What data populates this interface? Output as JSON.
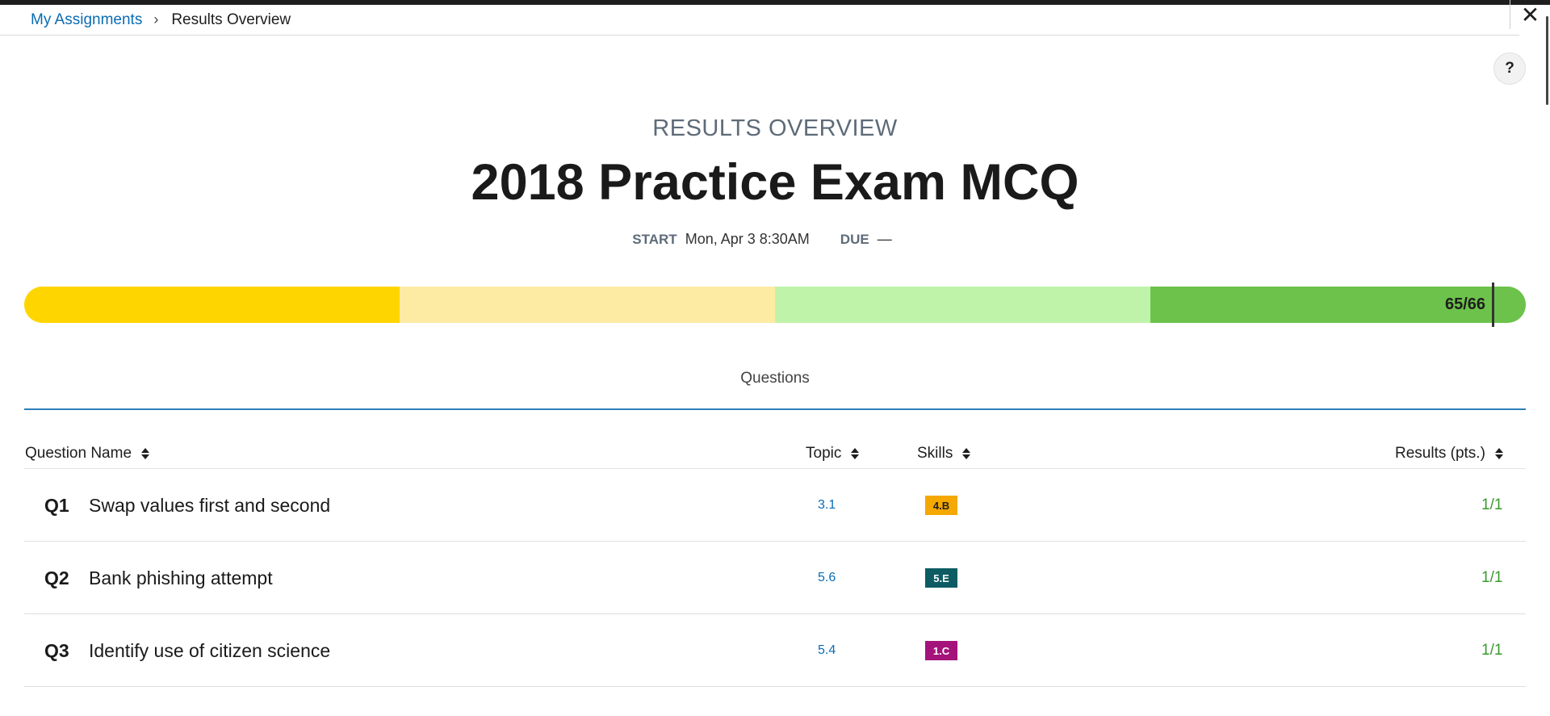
{
  "breadcrumb": {
    "parent": "My Assignments",
    "separator": "›",
    "current": "Results Overview"
  },
  "close_label": "✕",
  "help_label": "?",
  "overline": "RESULTS OVERVIEW",
  "title": "2018 Practice Exam MCQ",
  "dates": {
    "start_label": "START",
    "start_value": "Mon, Apr 3 8:30AM",
    "due_label": "DUE",
    "due_value": "—"
  },
  "score": {
    "text": "65/66",
    "earned": 65,
    "total": 66,
    "segment_colors": [
      "#ffd500",
      "#fdeba3",
      "#c0f3aa",
      "#6cc24a"
    ]
  },
  "tabs": [
    {
      "label": "Questions",
      "active": true
    }
  ],
  "columns": {
    "name": "Question Name",
    "topic": "Topic",
    "skills": "Skills",
    "results": "Results (pts.)"
  },
  "rows": [
    {
      "num": "Q1",
      "name": "Swap values first and second",
      "topic": "3.1",
      "skill": "4.B",
      "skill_bg": "#f5a800",
      "skill_fg": "#1e1e1e",
      "result": "1/1"
    },
    {
      "num": "Q2",
      "name": "Bank phishing attempt",
      "topic": "5.6",
      "skill": "5.E",
      "skill_bg": "#0d5c63",
      "skill_fg": "#ffffff",
      "result": "1/1"
    },
    {
      "num": "Q3",
      "name": "Identify use of citizen science",
      "topic": "5.4",
      "skill": "1.C",
      "skill_bg": "#a4137a",
      "skill_fg": "#ffffff",
      "result": "1/1"
    }
  ],
  "accent_colors": {
    "link": "#0a6cb4",
    "result_green": "#3a9a2e",
    "tab_underline": "#2d7fb8"
  }
}
